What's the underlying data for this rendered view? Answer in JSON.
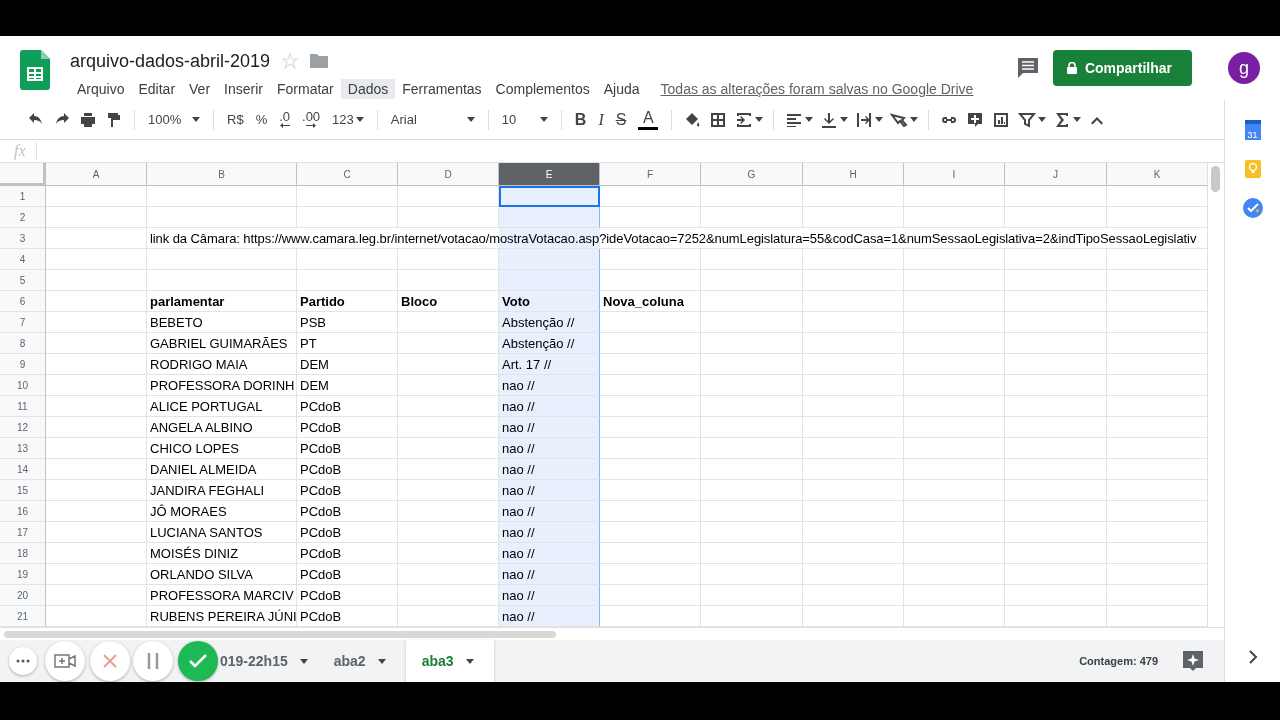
{
  "document": {
    "title": "arquivo-dados-abril-2019",
    "save_status": "Todas as alterações foram salvas no Google Drive"
  },
  "menu": [
    {
      "label": "Arquivo",
      "highlighted": false
    },
    {
      "label": "Editar",
      "highlighted": false
    },
    {
      "label": "Ver",
      "highlighted": false
    },
    {
      "label": "Inserir",
      "highlighted": false
    },
    {
      "label": "Formatar",
      "highlighted": false
    },
    {
      "label": "Dados",
      "highlighted": true
    },
    {
      "label": "Ferramentas",
      "highlighted": false
    },
    {
      "label": "Complementos",
      "highlighted": false
    },
    {
      "label": "Ajuda",
      "highlighted": false
    }
  ],
  "share_button": {
    "label": "Compartilhar"
  },
  "avatar": {
    "initial": "g"
  },
  "toolbar": [
    {
      "kind": "undo"
    },
    {
      "kind": "redo"
    },
    {
      "kind": "print"
    },
    {
      "kind": "paint-format"
    },
    {
      "kind": "separator"
    },
    {
      "kind": "zoom",
      "label": "100%"
    },
    {
      "kind": "separator"
    },
    {
      "kind": "text",
      "label": "R$"
    },
    {
      "kind": "text",
      "label": "%"
    },
    {
      "kind": "decimal-less",
      "label": ".0"
    },
    {
      "kind": "decimal-more",
      "label": ".00"
    },
    {
      "kind": "format-menu",
      "label": "123"
    },
    {
      "kind": "separator"
    },
    {
      "kind": "font",
      "label": "Arial"
    },
    {
      "kind": "separator"
    },
    {
      "kind": "size",
      "label": "10"
    },
    {
      "kind": "separator"
    },
    {
      "kind": "bold",
      "label": "B"
    },
    {
      "kind": "italic",
      "label": "I"
    },
    {
      "kind": "strike",
      "label": "S"
    },
    {
      "kind": "text-color",
      "label": "A"
    },
    {
      "kind": "separator"
    },
    {
      "kind": "fill"
    },
    {
      "kind": "borders"
    },
    {
      "kind": "merge"
    },
    {
      "kind": "separator"
    },
    {
      "kind": "align"
    },
    {
      "kind": "valign"
    },
    {
      "kind": "wrap"
    },
    {
      "kind": "rotate"
    },
    {
      "kind": "separator"
    },
    {
      "kind": "link"
    },
    {
      "kind": "comment"
    },
    {
      "kind": "chart"
    },
    {
      "kind": "filter"
    },
    {
      "kind": "sigma"
    },
    {
      "kind": "collapse"
    }
  ],
  "formula_bar": {
    "label": "fx"
  },
  "sheet": {
    "columns": [
      {
        "label": "A",
        "selected": false
      },
      {
        "label": "B",
        "selected": false
      },
      {
        "label": "C",
        "selected": false
      },
      {
        "label": "D",
        "selected": false
      },
      {
        "label": "E",
        "selected": true
      },
      {
        "label": "F",
        "selected": false
      },
      {
        "label": "G",
        "selected": false
      },
      {
        "label": "H",
        "selected": false
      },
      {
        "label": "I",
        "selected": false
      },
      {
        "label": "J",
        "selected": false
      },
      {
        "label": "K",
        "selected": false
      }
    ],
    "rows": [
      {
        "number": "1",
        "active": true
      },
      {
        "number": "2",
        "active": false
      },
      {
        "number": "3",
        "active": false,
        "bold": false,
        "column_b": "link da Câmara: https://www.camara.leg.br/internet/votacao/mostraVotacao.asp?ideVotacao=7252&numLegislatura=55&codCasa=1&numSessaoLegislativa=2&indTipoSessaoLegislativ"
      },
      {
        "number": "4",
        "active": false
      },
      {
        "number": "5",
        "active": false
      },
      {
        "number": "6",
        "active": false,
        "bold": true,
        "column_b": "parlamentar",
        "column_c": "Partido",
        "column_d": "Bloco",
        "column_e": "Voto",
        "column_f": "Nova_coluna"
      },
      {
        "number": "7",
        "active": false,
        "bold": false,
        "column_b": "BEBETO",
        "column_c": "PSB",
        "column_e": "Abstenção //"
      },
      {
        "number": "8",
        "active": false,
        "bold": false,
        "column_b": "GABRIEL GUIMARÃES",
        "column_c": "PT",
        "column_e": "Abstenção //"
      },
      {
        "number": "9",
        "active": false,
        "bold": false,
        "column_b": "RODRIGO MAIA",
        "column_c": "DEM",
        "column_e": "Art. 17 //"
      },
      {
        "number": "10",
        "active": false,
        "bold": false,
        "column_b": "PROFESSORA DORINH",
        "column_c": "DEM",
        "column_e": "nao //"
      },
      {
        "number": "11",
        "active": false,
        "bold": false,
        "column_b": "ALICE PORTUGAL",
        "column_c": "PCdoB",
        "column_e": "nao //"
      },
      {
        "number": "12",
        "active": false,
        "bold": false,
        "column_b": "ANGELA ALBINO",
        "column_c": "PCdoB",
        "column_e": "nao //"
      },
      {
        "number": "13",
        "active": false,
        "bold": false,
        "column_b": "CHICO LOPES",
        "column_c": "PCdoB",
        "column_e": "nao //"
      },
      {
        "number": "14",
        "active": false,
        "bold": false,
        "column_b": "DANIEL ALMEIDA",
        "column_c": "PCdoB",
        "column_e": "nao //"
      },
      {
        "number": "15",
        "active": false,
        "bold": false,
        "column_b": "JANDIRA FEGHALI",
        "column_c": "PCdoB",
        "column_e": "nao //"
      },
      {
        "number": "16",
        "active": false,
        "bold": false,
        "column_b": "JÔ MORAES",
        "column_c": "PCdoB",
        "column_e": "nao //"
      },
      {
        "number": "17",
        "active": false,
        "bold": false,
        "column_b": "LUCIANA SANTOS",
        "column_c": "PCdoB",
        "column_e": "nao //"
      },
      {
        "number": "18",
        "active": false,
        "bold": false,
        "column_b": "MOISÉS DINIZ",
        "column_c": "PCdoB",
        "column_e": "nao //"
      },
      {
        "number": "19",
        "active": false,
        "bold": false,
        "column_b": "ORLANDO SILVA",
        "column_c": "PCdoB",
        "column_e": "nao //"
      },
      {
        "number": "20",
        "active": false,
        "bold": false,
        "column_b": "PROFESSORA MARCIV",
        "column_c": "PCdoB",
        "column_e": "nao //"
      },
      {
        "number": "21",
        "active": false,
        "bold": false,
        "column_b": "RUBENS PEREIRA JÚNI",
        "column_c": "PCdoB",
        "column_e": "nao //"
      }
    ]
  },
  "side_panel": {
    "calendar_day": "31"
  },
  "recorder": [
    {
      "kind": "more"
    },
    {
      "kind": "camera"
    },
    {
      "kind": "cancel"
    },
    {
      "kind": "pause"
    },
    {
      "kind": "done"
    }
  ],
  "sheet_tabs": [
    {
      "label": "019-22h15",
      "selected": false
    },
    {
      "label": "aba2",
      "selected": false
    },
    {
      "label": "aba3",
      "selected": true
    }
  ],
  "status": {
    "count": "Contagem: 479"
  }
}
